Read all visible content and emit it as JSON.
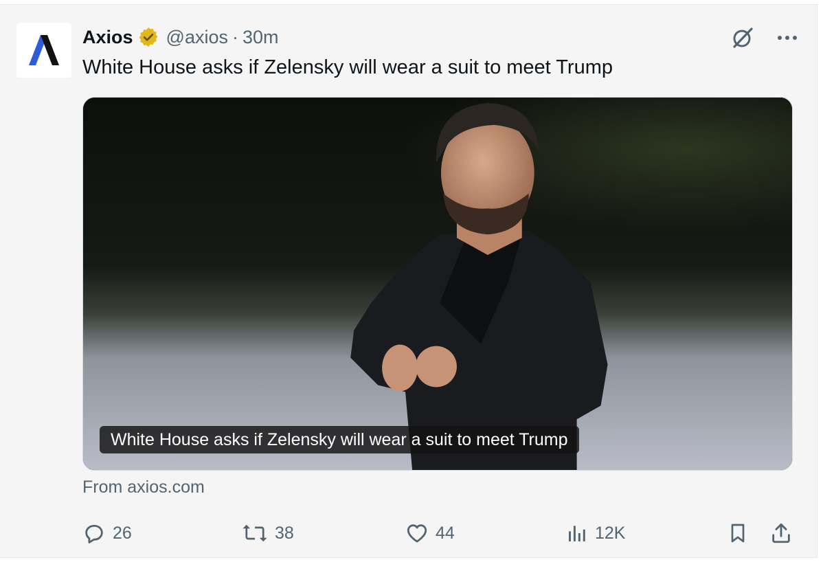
{
  "author": {
    "name": "Axios",
    "handle": "@axios",
    "separator": "·",
    "time": "30m",
    "verified_badge_color": "#e2b719"
  },
  "tweet": {
    "text": "White House asks if Zelensky will wear a suit to meet Trump"
  },
  "card": {
    "caption": "White House asks if Zelensky will wear a suit to meet Trump",
    "source": "From axios.com"
  },
  "stats": {
    "replies": "26",
    "reposts": "38",
    "likes": "44",
    "views": "12K"
  },
  "icons": [
    "axios-logo",
    "verified-badge-icon",
    "grok-icon",
    "more-icon",
    "reply-icon",
    "repost-icon",
    "like-icon",
    "views-icon",
    "bookmark-icon",
    "share-icon"
  ],
  "colors": {
    "text_primary": "#0f1419",
    "text_secondary": "#536471",
    "logo_blue": "#2e5bd8",
    "background": "#f5f5f5"
  }
}
